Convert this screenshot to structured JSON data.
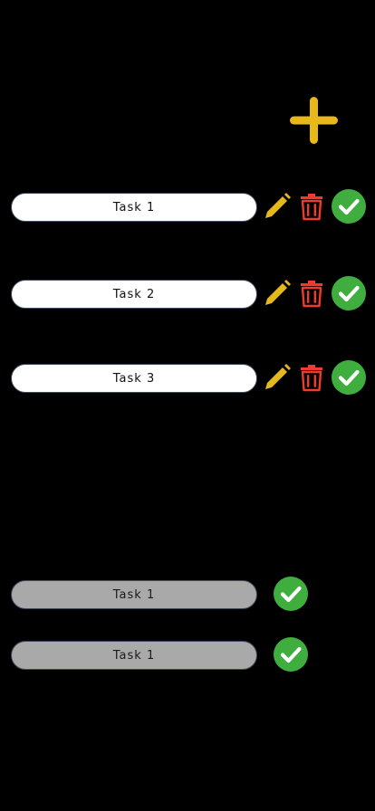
{
  "colors": {
    "background": "#000000",
    "accent_yellow": "#e6b81e",
    "delete_red": "#f03a2e",
    "check_green": "#3fae3f",
    "pill_active": "#ffffff",
    "pill_done": "#a9a9a9",
    "pill_border": "#3e4a5e"
  },
  "add_icon": "plus-icon",
  "active_tasks": [
    {
      "label": "Task 1",
      "icons": [
        "pencil-icon",
        "trash-icon",
        "check-circle-icon"
      ]
    },
    {
      "label": "Task 2",
      "icons": [
        "pencil-icon",
        "trash-icon",
        "check-circle-icon"
      ]
    },
    {
      "label": "Task 3",
      "icons": [
        "pencil-icon",
        "trash-icon",
        "check-circle-icon"
      ]
    }
  ],
  "completed_tasks": [
    {
      "label": "Task 1",
      "icons": [
        "check-circle-icon"
      ]
    },
    {
      "label": "Task 1",
      "icons": [
        "check-circle-icon"
      ]
    }
  ]
}
